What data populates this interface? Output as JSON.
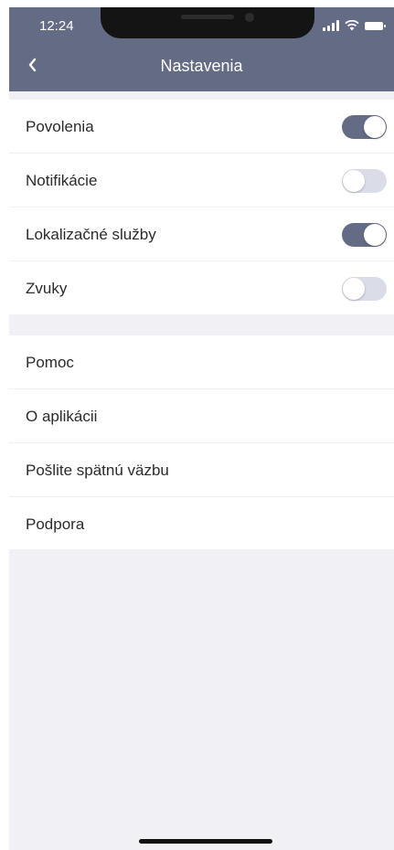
{
  "status_bar": {
    "time": "12:24"
  },
  "header": {
    "back_icon": "chevron-left-icon",
    "title": "Nastavenia"
  },
  "toggles": [
    {
      "label": "Povolenia",
      "enabled": true
    },
    {
      "label": "Notifikácie",
      "enabled": false
    },
    {
      "label": "Lokalizačné služby",
      "enabled": true
    },
    {
      "label": "Zvuky",
      "enabled": false
    }
  ],
  "links": [
    {
      "label": "Pomoc"
    },
    {
      "label": "O aplikácii"
    },
    {
      "label": "Pošlite spätnú väzbu"
    },
    {
      "label": "Podpora"
    }
  ],
  "colors": {
    "accent": "#646b84",
    "background": "#f0f0f5",
    "toggle_off": "#dadce8"
  }
}
